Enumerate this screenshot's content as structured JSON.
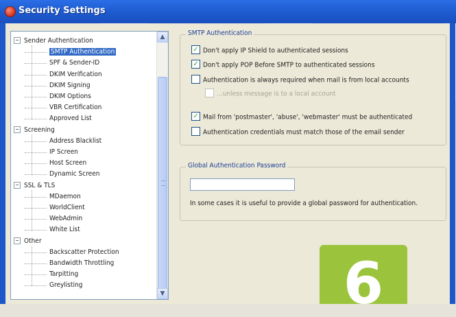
{
  "window": {
    "title": "Security Settings"
  },
  "tree": {
    "groups": [
      {
        "label": "Sender Authentication",
        "expander": "−",
        "items": [
          "SMTP Authentication",
          "SPF & Sender-ID",
          "DKIM Verification",
          "DKIM Signing",
          "DKIM Options",
          "VBR Certification",
          "Approved List"
        ]
      },
      {
        "label": "Screening",
        "expander": "−",
        "items": [
          "Address Blacklist",
          "IP Screen",
          "Host Screen",
          "Dynamic Screen"
        ]
      },
      {
        "label": "SSL & TLS",
        "expander": "−",
        "items": [
          "MDaemon",
          "WorldClient",
          "WebAdmin",
          "White List"
        ]
      },
      {
        "label": "Other",
        "expander": "−",
        "items": [
          "Backscatter Protection",
          "Bandwidth Throttling",
          "Tarpitting",
          "Greylisting"
        ]
      }
    ],
    "selected": "SMTP Authentication",
    "scroll_up": "▲",
    "scroll_down": "▼"
  },
  "smtp_auth": {
    "legend": "SMTP Authentication",
    "options": [
      {
        "label": "Don't apply IP Shield to authenticated sessions",
        "checked": true
      },
      {
        "label": "Don't apply POP Before SMTP to authenticated sessions",
        "checked": true
      },
      {
        "label": "Authentication is always required when mail is from local accounts",
        "checked": false
      },
      {
        "label": "...unless message is to a local account",
        "checked": false,
        "disabled": true
      },
      {
        "label": "Mail from 'postmaster', 'abuse', 'webmaster' must be authenticated",
        "checked": true
      },
      {
        "label": "Authentication credentials must match those of the email sender",
        "checked": false
      }
    ]
  },
  "global_pw": {
    "legend": "Global Authentication Password",
    "value": "",
    "help": "In some cases it is useful to provide a global password for authentication."
  },
  "badge": {
    "number": "6",
    "color": "#9bc43c"
  },
  "check_glyph": "✓"
}
